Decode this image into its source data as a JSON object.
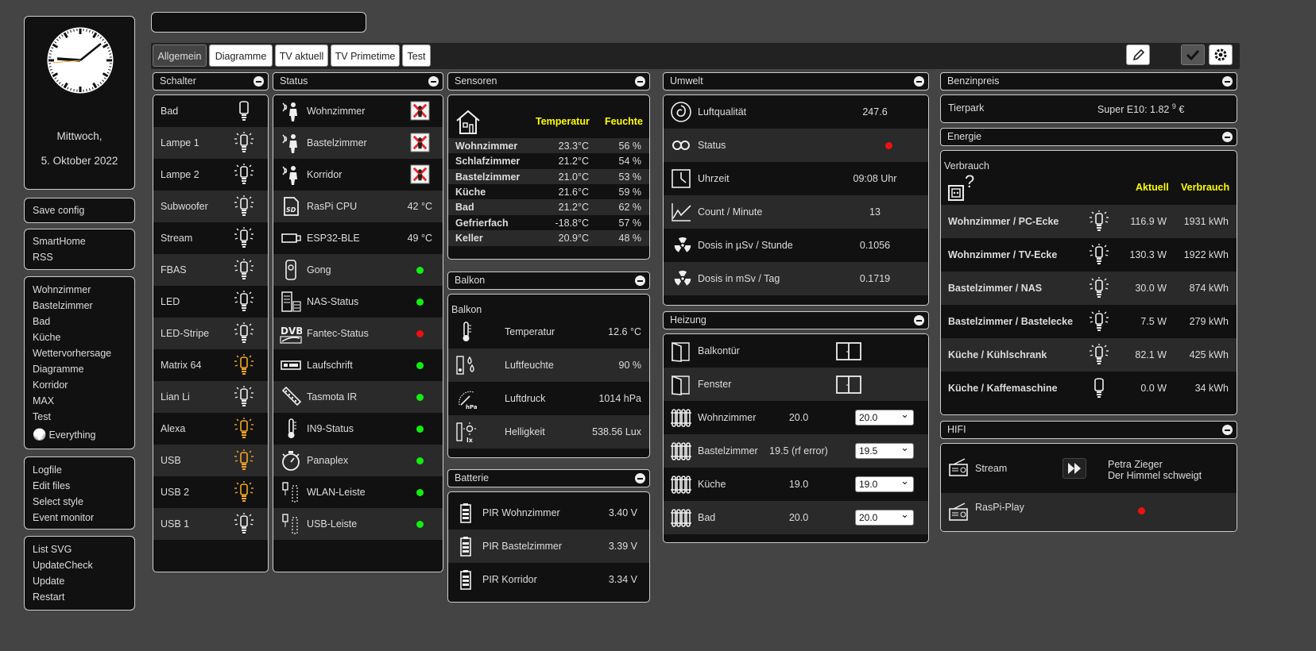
{
  "clock": {
    "day": "Mittwoch,",
    "date": "5. Oktober 2022"
  },
  "menu1": [
    "Save config"
  ],
  "menu2": [
    "SmartHome",
    "RSS"
  ],
  "menu3": [
    "Wohnzimmer",
    "Bastelzimmer",
    "Bad",
    "Küche",
    "Wettervorhersage",
    "Diagramme",
    "Korridor",
    "MAX",
    "Test"
  ],
  "menu3_last": "Everything",
  "menu4": [
    "Logfile",
    "Edit files",
    "Select style",
    "Event monitor"
  ],
  "menu5": [
    "List SVG",
    "UpdateCheck",
    "Update",
    "Restart"
  ],
  "tabs": [
    "Allgemein",
    "Diagramme",
    "TV aktuell",
    "TV Primetime",
    "Test"
  ],
  "schalter": {
    "title": "Schalter",
    "items": [
      {
        "name": "Bad",
        "state": "off"
      },
      {
        "name": "Lampe 1",
        "state": "off"
      },
      {
        "name": "Lampe 2",
        "state": "off"
      },
      {
        "name": "Subwoofer",
        "state": "off"
      },
      {
        "name": "Stream",
        "state": "off"
      },
      {
        "name": "FBAS",
        "state": "off"
      },
      {
        "name": "LED",
        "state": "off"
      },
      {
        "name": "LED-Stripe",
        "state": "off"
      },
      {
        "name": "Matrix 64",
        "state": "on"
      },
      {
        "name": "Lian Li",
        "state": "off"
      },
      {
        "name": "Alexa",
        "state": "on"
      },
      {
        "name": "USB",
        "state": "on"
      },
      {
        "name": "USB 2",
        "state": "on"
      },
      {
        "name": "USB 1",
        "state": "off"
      }
    ]
  },
  "status": {
    "title": "Status",
    "items": [
      {
        "name": "Wohnzimmer",
        "value": "",
        "icon": "presence-icon",
        "mark": "x"
      },
      {
        "name": "Bastelzimmer",
        "value": "",
        "icon": "presence-icon",
        "mark": "x"
      },
      {
        "name": "Korridor",
        "value": "",
        "icon": "presence-icon",
        "mark": "x"
      },
      {
        "name": "RasPi CPU",
        "value": "42 °C",
        "icon": "sdcard-icon",
        "mark": ""
      },
      {
        "name": "ESP32-BLE",
        "value": "49 °C",
        "icon": "usb-stick-icon",
        "mark": ""
      },
      {
        "name": "Gong",
        "value": "",
        "icon": "doorbell-icon",
        "mark": "green"
      },
      {
        "name": "NAS-Status",
        "value": "",
        "icon": "nas-icon",
        "mark": "green"
      },
      {
        "name": "Fantec-Status",
        "value": "",
        "icon": "dvb-icon",
        "mark": "red"
      },
      {
        "name": "Laufschrift",
        "value": "",
        "icon": "display-icon",
        "mark": "green"
      },
      {
        "name": "Tasmota IR",
        "value": "",
        "icon": "remote-icon",
        "mark": "green"
      },
      {
        "name": "IN9-Status",
        "value": "",
        "icon": "thermometer-icon",
        "mark": "green"
      },
      {
        "name": "Panaplex",
        "value": "",
        "icon": "stopwatch-icon",
        "mark": "green"
      },
      {
        "name": "WLAN-Leiste",
        "value": "",
        "icon": "power-strip-icon",
        "mark": "green"
      },
      {
        "name": "USB-Leiste",
        "value": "",
        "icon": "power-strip-icon",
        "mark": "green"
      }
    ]
  },
  "sensoren": {
    "title": "Sensoren",
    "col1": "Temperatur",
    "col2": "Feuchte",
    "rows": [
      [
        "Wohnzimmer",
        "23.3°C",
        "56 %"
      ],
      [
        "Schlafzimmer",
        "21.2°C",
        "54 %"
      ],
      [
        "Bastelzimmer",
        "21.0°C",
        "53 %"
      ],
      [
        "Küche",
        "21.6°C",
        "59 %"
      ],
      [
        "Bad",
        "21.2°C",
        "62 %"
      ],
      [
        "Gefrierfach",
        "-18.8°C",
        "57 %"
      ],
      [
        "Keller",
        "20.9°C",
        "48 %"
      ]
    ]
  },
  "balkon": {
    "title": "Balkon",
    "sub": "Balkon",
    "rows": [
      [
        "Temperatur",
        "12.6 °C"
      ],
      [
        "Luftfeuchte",
        "90 %"
      ],
      [
        "Luftdruck",
        "1014 hPa"
      ],
      [
        "Helligkeit",
        "538.56 Lux"
      ]
    ]
  },
  "batterie": {
    "title": "Batterie",
    "rows": [
      [
        "PIR Wohnzimmer",
        "3.40 V"
      ],
      [
        "PIR Bastelzimmer",
        "3.39 V"
      ],
      [
        "PIR Korridor",
        "3.34 V"
      ]
    ]
  },
  "umwelt": {
    "title": "Umwelt",
    "rows": [
      [
        "Luftqualität",
        "247.6"
      ],
      [
        "Status",
        ""
      ],
      [
        "Uhrzeit",
        "09:08 Uhr"
      ],
      [
        "Count / Minute",
        "13"
      ],
      [
        "Dosis in µSv / Stunde",
        "0.1056"
      ],
      [
        "Dosis in mSv / Tag",
        "0.1719"
      ]
    ]
  },
  "heizung": {
    "title": "Heizung",
    "windows": [
      "Balkontür",
      "Fenster"
    ],
    "rows": [
      [
        "Wohnzimmer",
        "20.0",
        "20.0"
      ],
      [
        "Bastelzimmer",
        "19.5 (rf error)",
        "19.5"
      ],
      [
        "Küche",
        "19.0",
        "19.0"
      ],
      [
        "Bad",
        "20.0",
        "20.0"
      ]
    ]
  },
  "benzin": {
    "title": "Benzinpreis",
    "station": "Tierpark",
    "price": "Super E10: 1.82",
    "sup": "9",
    "cur": "€"
  },
  "energie": {
    "title": "Energie",
    "sub": "Verbrauch",
    "q": "?",
    "col1": "Aktuell",
    "col2": "Verbrauch",
    "rows": [
      [
        "Wohnzimmer / PC-Ecke",
        "116.9 W",
        "1931 kWh",
        "on"
      ],
      [
        "Wohnzimmer / TV-Ecke",
        "130.3 W",
        "1922 kWh",
        "on"
      ],
      [
        "Bastelzimmer / NAS",
        "30.0 W",
        "874 kWh",
        "on"
      ],
      [
        "Bastelzimmer / Bastelecke",
        "7.5 W",
        "279 kWh",
        "on"
      ],
      [
        "Küche / Kühlschrank",
        "82.1 W",
        "425 kWh",
        "on"
      ],
      [
        "Küche / Kaffemaschine",
        "0.0 W",
        "34 kWh",
        "off"
      ]
    ]
  },
  "hifi": {
    "title": "HIFI",
    "stream": "Stream",
    "artist": "Petra Zieger",
    "track": "Der Himmel schweigt",
    "raspi": "RasPi-Play"
  },
  "colors": {
    "accent_yellow": "#ffff00",
    "status_green": "#11ee11",
    "status_red": "#ee1111",
    "lamp_on": "#f5a623"
  }
}
